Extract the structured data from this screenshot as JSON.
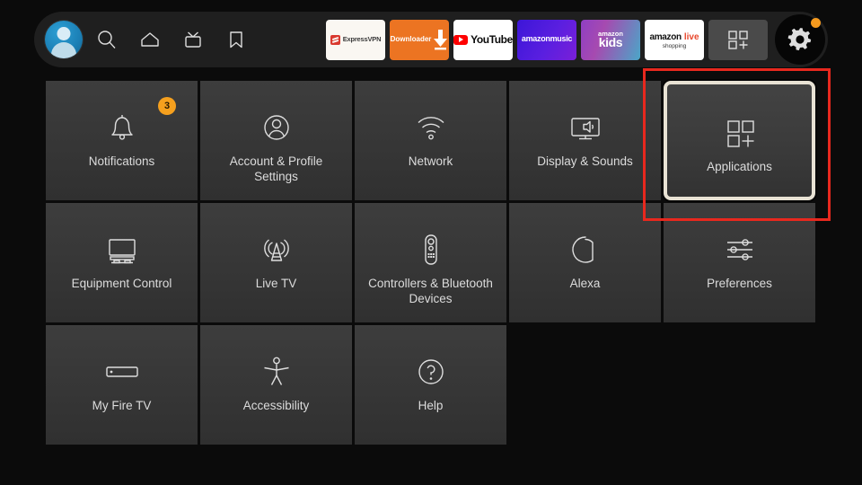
{
  "topbar": {
    "avatar": {
      "name": "profile-avatar"
    },
    "nav": [
      {
        "id": "search",
        "icon": "search-icon",
        "label": "Search"
      },
      {
        "id": "home",
        "icon": "home-icon",
        "label": "Home"
      },
      {
        "id": "live",
        "icon": "live-tv-icon",
        "label": "Live"
      },
      {
        "id": "bookmark",
        "icon": "bookmark-icon",
        "label": "Watchlist"
      }
    ],
    "apps": [
      {
        "id": "expressvpn",
        "label": "ExpressVPN",
        "bg": "#faf7f2"
      },
      {
        "id": "downloader",
        "label": "Downloader",
        "bg": "#ec7422"
      },
      {
        "id": "youtube",
        "label": "YouTube",
        "bg": "#ffffff"
      },
      {
        "id": "amazonmusic",
        "label_top": "amazon",
        "label_bottom": "music",
        "bg": "#3c16d8"
      },
      {
        "id": "amazonkids",
        "label_top": "amazon",
        "label_bottom": "kids",
        "bg": "#8f3fc4"
      },
      {
        "id": "amazonlive",
        "label_amazon": "amazon",
        "label_live": "live",
        "label_shopping": "shopping",
        "bg": "#ffffff"
      },
      {
        "id": "apps-grid",
        "label": "Apps",
        "bg": "#4a4a4a"
      }
    ],
    "gear": {
      "icon": "gear-icon",
      "label": "Settings",
      "has_notification_dot": true,
      "dot_color": "#f59a1e"
    }
  },
  "grid": {
    "tiles": [
      {
        "id": "notifications",
        "label": "Notifications",
        "icon": "bell-icon",
        "badge": "3"
      },
      {
        "id": "account-profile-settings",
        "label": "Account & Profile Settings",
        "icon": "person-circle-icon"
      },
      {
        "id": "network",
        "label": "Network",
        "icon": "wifi-icon"
      },
      {
        "id": "display-sounds",
        "label": "Display & Sounds",
        "icon": "tv-speaker-icon"
      },
      {
        "id": "applications",
        "label": "Applications",
        "icon": "apps-grid-plus-icon",
        "focused": true
      },
      {
        "id": "equipment-control",
        "label": "Equipment Control",
        "icon": "tv-stand-icon"
      },
      {
        "id": "live-tv",
        "label": "Live TV",
        "icon": "broadcast-tower-icon"
      },
      {
        "id": "controllers-bluetooth-devices",
        "label": "Controllers & Bluetooth Devices",
        "icon": "remote-control-icon"
      },
      {
        "id": "alexa",
        "label": "Alexa",
        "icon": "alexa-ring-icon"
      },
      {
        "id": "preferences",
        "label": "Preferences",
        "icon": "sliders-icon"
      },
      {
        "id": "my-fire-tv",
        "label": "My Fire TV",
        "icon": "fire-tv-stick-icon"
      },
      {
        "id": "accessibility",
        "label": "Accessibility",
        "icon": "accessibility-person-icon"
      },
      {
        "id": "help",
        "label": "Help",
        "icon": "question-circle-icon"
      }
    ]
  },
  "annotation": {
    "color": "#e8281e",
    "target": "applications"
  }
}
